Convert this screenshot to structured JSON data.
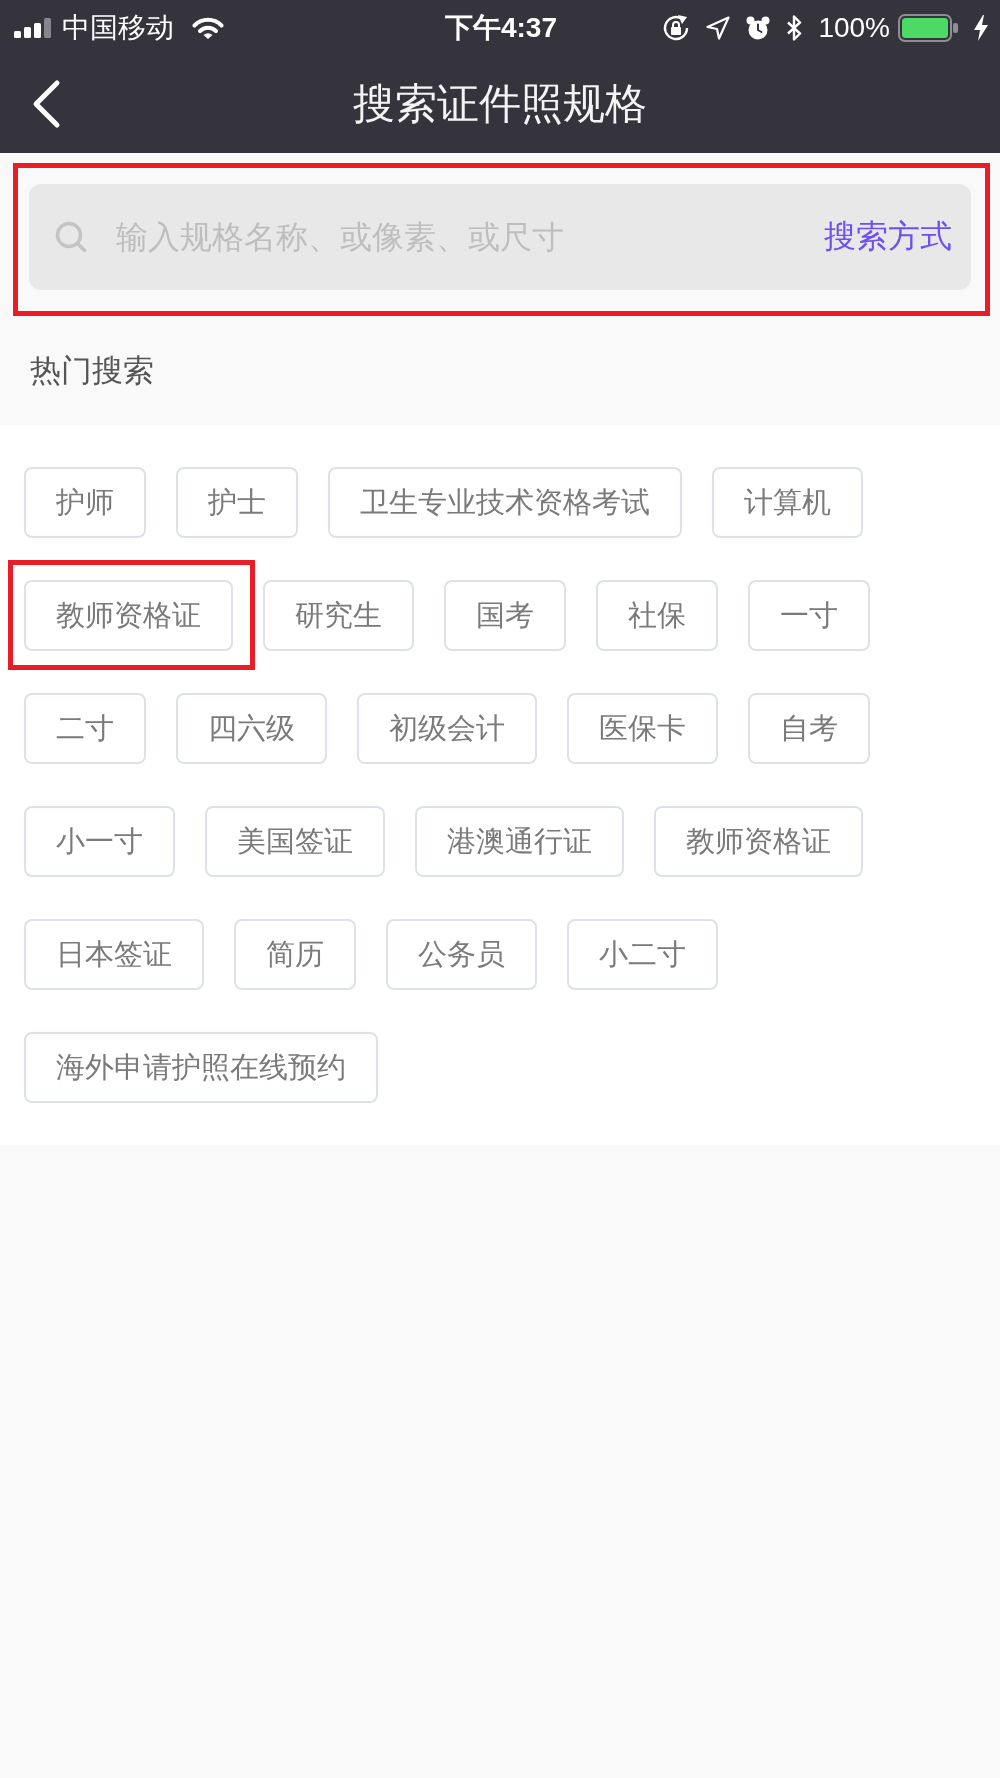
{
  "status_bar": {
    "carrier": "中国移动",
    "time": "下午4:37",
    "battery_text": "100%"
  },
  "nav_bar": {
    "title": "搜索证件照规格"
  },
  "search": {
    "placeholder": "输入规格名称、或像素、或尺寸",
    "mode_link": "搜索方式",
    "highlighted": true
  },
  "hot_search": {
    "heading": "热门搜索",
    "tags": [
      {
        "label": "护师",
        "highlighted": false
      },
      {
        "label": "护士",
        "highlighted": false
      },
      {
        "label": "卫生专业技术资格考试",
        "highlighted": false
      },
      {
        "label": "计算机",
        "highlighted": false
      },
      {
        "label": "教师资格证",
        "highlighted": true
      },
      {
        "label": "研究生",
        "highlighted": false
      },
      {
        "label": "国考",
        "highlighted": false
      },
      {
        "label": "社保",
        "highlighted": false
      },
      {
        "label": "一寸",
        "highlighted": false
      },
      {
        "label": "二寸",
        "highlighted": false
      },
      {
        "label": "四六级",
        "highlighted": false
      },
      {
        "label": "初级会计",
        "highlighted": false
      },
      {
        "label": "医保卡",
        "highlighted": false
      },
      {
        "label": "自考",
        "highlighted": false
      },
      {
        "label": "小一寸",
        "highlighted": false
      },
      {
        "label": "美国签证",
        "highlighted": false
      },
      {
        "label": "港澳通行证",
        "highlighted": false
      },
      {
        "label": "教师资格证",
        "highlighted": false
      },
      {
        "label": "日本签证",
        "highlighted": false
      },
      {
        "label": "简历",
        "highlighted": false
      },
      {
        "label": "公务员",
        "highlighted": false
      },
      {
        "label": "小二寸",
        "highlighted": false
      },
      {
        "label": "海外申请护照在线预约",
        "highlighted": false
      }
    ]
  }
}
